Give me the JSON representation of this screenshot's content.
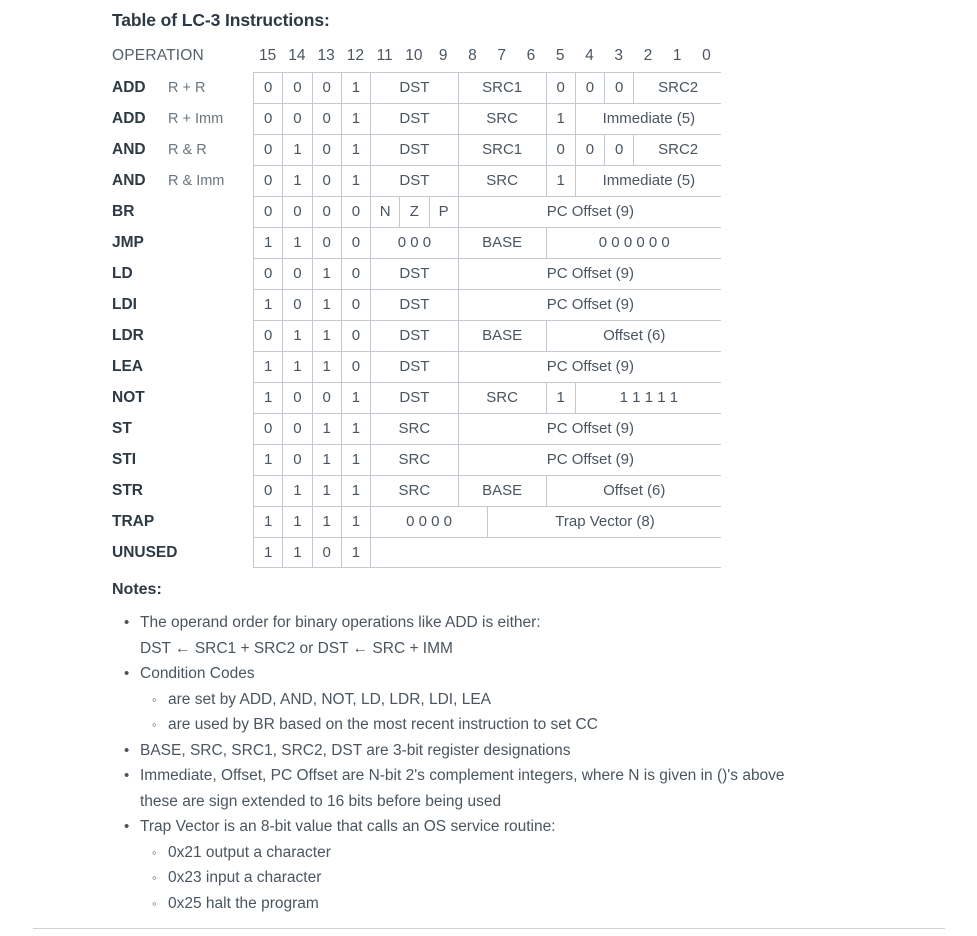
{
  "document": {
    "title": "Table of LC-3 Instructions:",
    "notes_heading": "Notes:"
  },
  "table": {
    "operation_header": "OPERATION",
    "bit_numbers": [
      "15",
      "14",
      "13",
      "12",
      "11",
      "10",
      "9",
      "8",
      "7",
      "6",
      "5",
      "4",
      "3",
      "2",
      "1",
      "0"
    ],
    "rows": [
      {
        "mnemonic": "ADD",
        "variant": "R + R",
        "cells": [
          {
            "text": "0",
            "bits": 1
          },
          {
            "text": "0",
            "bits": 1
          },
          {
            "text": "0",
            "bits": 1
          },
          {
            "text": "1",
            "bits": 1
          },
          {
            "text": "DST",
            "bits": 3
          },
          {
            "text": "SRC1",
            "bits": 3
          },
          {
            "text": "0",
            "bits": 1
          },
          {
            "text": "0",
            "bits": 1
          },
          {
            "text": "0",
            "bits": 1
          },
          {
            "text": "SRC2",
            "bits": 3
          }
        ]
      },
      {
        "mnemonic": "ADD",
        "variant": "R + Imm",
        "cells": [
          {
            "text": "0",
            "bits": 1
          },
          {
            "text": "0",
            "bits": 1
          },
          {
            "text": "0",
            "bits": 1
          },
          {
            "text": "1",
            "bits": 1
          },
          {
            "text": "DST",
            "bits": 3
          },
          {
            "text": "SRC",
            "bits": 3
          },
          {
            "text": "1",
            "bits": 1
          },
          {
            "text": "Immediate (5)",
            "bits": 5
          }
        ]
      },
      {
        "mnemonic": "AND",
        "variant": "R & R",
        "cells": [
          {
            "text": "0",
            "bits": 1
          },
          {
            "text": "1",
            "bits": 1
          },
          {
            "text": "0",
            "bits": 1
          },
          {
            "text": "1",
            "bits": 1
          },
          {
            "text": "DST",
            "bits": 3
          },
          {
            "text": "SRC1",
            "bits": 3
          },
          {
            "text": "0",
            "bits": 1
          },
          {
            "text": "0",
            "bits": 1
          },
          {
            "text": "0",
            "bits": 1
          },
          {
            "text": "SRC2",
            "bits": 3
          }
        ]
      },
      {
        "mnemonic": "AND",
        "variant": "R & Imm",
        "cells": [
          {
            "text": "0",
            "bits": 1
          },
          {
            "text": "1",
            "bits": 1
          },
          {
            "text": "0",
            "bits": 1
          },
          {
            "text": "1",
            "bits": 1
          },
          {
            "text": "DST",
            "bits": 3
          },
          {
            "text": "SRC",
            "bits": 3
          },
          {
            "text": "1",
            "bits": 1
          },
          {
            "text": "Immediate (5)",
            "bits": 5
          }
        ]
      },
      {
        "mnemonic": "BR",
        "variant": "",
        "cells": [
          {
            "text": "0",
            "bits": 1
          },
          {
            "text": "0",
            "bits": 1
          },
          {
            "text": "0",
            "bits": 1
          },
          {
            "text": "0",
            "bits": 1
          },
          {
            "text": "N",
            "bits": 1
          },
          {
            "text": "Z",
            "bits": 1
          },
          {
            "text": "P",
            "bits": 1
          },
          {
            "text": "PC Offset (9)",
            "bits": 9
          }
        ]
      },
      {
        "mnemonic": "JMP",
        "variant": "",
        "cells": [
          {
            "text": "1",
            "bits": 1
          },
          {
            "text": "1",
            "bits": 1
          },
          {
            "text": "0",
            "bits": 1
          },
          {
            "text": "0",
            "bits": 1
          },
          {
            "text": "0 0 0",
            "bits": 3
          },
          {
            "text": "BASE",
            "bits": 3
          },
          {
            "text": "0  0  0  0  0  0",
            "bits": 6
          }
        ]
      },
      {
        "mnemonic": "LD",
        "variant": "",
        "cells": [
          {
            "text": "0",
            "bits": 1
          },
          {
            "text": "0",
            "bits": 1
          },
          {
            "text": "1",
            "bits": 1
          },
          {
            "text": "0",
            "bits": 1
          },
          {
            "text": "DST",
            "bits": 3
          },
          {
            "text": "PC Offset (9)",
            "bits": 9
          }
        ]
      },
      {
        "mnemonic": "LDI",
        "variant": "",
        "cells": [
          {
            "text": "1",
            "bits": 1
          },
          {
            "text": "0",
            "bits": 1
          },
          {
            "text": "1",
            "bits": 1
          },
          {
            "text": "0",
            "bits": 1
          },
          {
            "text": "DST",
            "bits": 3
          },
          {
            "text": "PC Offset (9)",
            "bits": 9
          }
        ]
      },
      {
        "mnemonic": "LDR",
        "variant": "",
        "cells": [
          {
            "text": "0",
            "bits": 1
          },
          {
            "text": "1",
            "bits": 1
          },
          {
            "text": "1",
            "bits": 1
          },
          {
            "text": "0",
            "bits": 1
          },
          {
            "text": "DST",
            "bits": 3
          },
          {
            "text": "BASE",
            "bits": 3
          },
          {
            "text": "Offset (6)",
            "bits": 6
          }
        ]
      },
      {
        "mnemonic": "LEA",
        "variant": "",
        "cells": [
          {
            "text": "1",
            "bits": 1
          },
          {
            "text": "1",
            "bits": 1
          },
          {
            "text": "1",
            "bits": 1
          },
          {
            "text": "0",
            "bits": 1
          },
          {
            "text": "DST",
            "bits": 3
          },
          {
            "text": "PC Offset (9)",
            "bits": 9
          }
        ]
      },
      {
        "mnemonic": "NOT",
        "variant": "",
        "cells": [
          {
            "text": "1",
            "bits": 1
          },
          {
            "text": "0",
            "bits": 1
          },
          {
            "text": "0",
            "bits": 1
          },
          {
            "text": "1",
            "bits": 1
          },
          {
            "text": "DST",
            "bits": 3
          },
          {
            "text": "SRC",
            "bits": 3
          },
          {
            "text": "1",
            "bits": 1
          },
          {
            "text": "1  1  1  1  1",
            "bits": 5
          }
        ]
      },
      {
        "mnemonic": "ST",
        "variant": "",
        "cells": [
          {
            "text": "0",
            "bits": 1
          },
          {
            "text": "0",
            "bits": 1
          },
          {
            "text": "1",
            "bits": 1
          },
          {
            "text": "1",
            "bits": 1
          },
          {
            "text": "SRC",
            "bits": 3
          },
          {
            "text": "PC Offset (9)",
            "bits": 9
          }
        ]
      },
      {
        "mnemonic": "STI",
        "variant": "",
        "cells": [
          {
            "text": "1",
            "bits": 1
          },
          {
            "text": "0",
            "bits": 1
          },
          {
            "text": "1",
            "bits": 1
          },
          {
            "text": "1",
            "bits": 1
          },
          {
            "text": "SRC",
            "bits": 3
          },
          {
            "text": "PC Offset (9)",
            "bits": 9
          }
        ]
      },
      {
        "mnemonic": "STR",
        "variant": "",
        "cells": [
          {
            "text": "0",
            "bits": 1
          },
          {
            "text": "1",
            "bits": 1
          },
          {
            "text": "1",
            "bits": 1
          },
          {
            "text": "1",
            "bits": 1
          },
          {
            "text": "SRC",
            "bits": 3
          },
          {
            "text": "BASE",
            "bits": 3
          },
          {
            "text": "Offset (6)",
            "bits": 6
          }
        ]
      },
      {
        "mnemonic": "TRAP",
        "variant": "",
        "cells": [
          {
            "text": "1",
            "bits": 1
          },
          {
            "text": "1",
            "bits": 1
          },
          {
            "text": "1",
            "bits": 1
          },
          {
            "text": "1",
            "bits": 1
          },
          {
            "text": "0   0   0   0",
            "bits": 4
          },
          {
            "text": "Trap Vector (8)",
            "bits": 8
          }
        ]
      },
      {
        "mnemonic": "UNUSED",
        "variant": "",
        "cells": [
          {
            "text": "1",
            "bits": 1
          },
          {
            "text": "1",
            "bits": 1
          },
          {
            "text": "0",
            "bits": 1
          },
          {
            "text": "1",
            "bits": 1
          },
          {
            "text": "",
            "bits": 12
          }
        ]
      }
    ]
  },
  "notes": [
    {
      "text": "The operand order for binary operations like ADD is either:",
      "continuation": "DST ← SRC1 + SRC2    or    DST ← SRC + IMM",
      "sub": []
    },
    {
      "text": "Condition Codes",
      "continuation": "",
      "sub": [
        "are set by ADD, AND, NOT, LD, LDR, LDI, LEA",
        "are used by BR based on the most recent instruction to set CC"
      ]
    },
    {
      "text": "BASE, SRC, SRC1, SRC2, DST are 3-bit register designations",
      "continuation": "",
      "sub": []
    },
    {
      "text": "Immediate, Offset, PC Offset are N-bit 2's complement integers, where N is given in ()'s above",
      "continuation": "these are sign extended to 16 bits before being used",
      "sub": []
    },
    {
      "text": "Trap Vector is an 8-bit value that calls an OS service routine:",
      "continuation": "",
      "sub": [
        "0x21 output a character",
        "0x23 input a character",
        "0x25 halt the program"
      ]
    }
  ],
  "bullets": {
    "level1": "•",
    "level2": "◦"
  },
  "colors": {
    "text": "#4a5560",
    "heading": "#2d3a45",
    "border": "#c3c9ce",
    "variant": "#6b757e",
    "rule": "#cfd4d8"
  }
}
